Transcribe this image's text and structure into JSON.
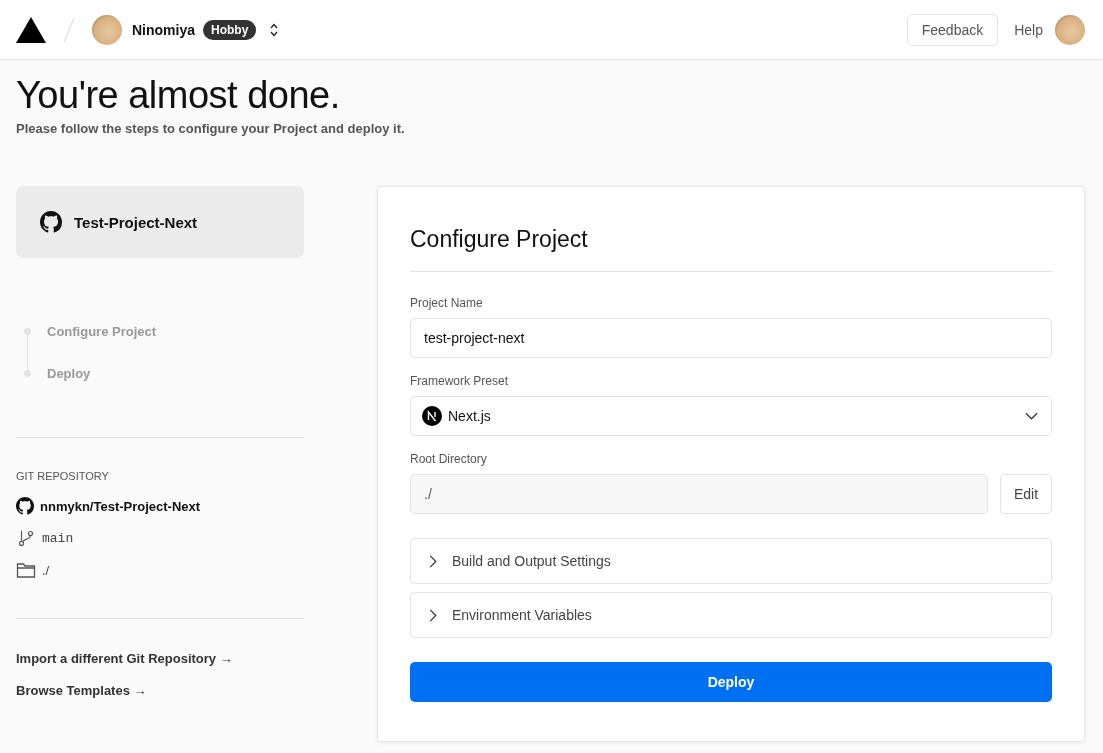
{
  "header": {
    "team_name": "Ninomiya",
    "plan_badge": "Hobby",
    "feedback_button": "Feedback",
    "help_link": "Help"
  },
  "page": {
    "title": "You're almost done.",
    "subtitle": "Please follow the steps to configure your Project and deploy it."
  },
  "sidebar": {
    "repo_card": "Test-Project-Next",
    "steps": [
      {
        "label": "Configure Project"
      },
      {
        "label": "Deploy"
      }
    ],
    "git_heading": "GIT REPOSITORY",
    "repository": "nnmykn/Test-Project-Next",
    "branch": "main",
    "directory": "./",
    "links": [
      "Import a different Git Repository →",
      "Browse Templates →"
    ]
  },
  "form": {
    "title": "Configure Project",
    "project_name": {
      "label": "Project Name",
      "value": "test-project-next"
    },
    "framework": {
      "label": "Framework Preset",
      "value": "Next.js"
    },
    "root_directory": {
      "label": "Root Directory",
      "value": "./",
      "edit_button": "Edit"
    },
    "sections": [
      {
        "label": "Build and Output Settings",
        "expanded": false
      },
      {
        "label": "Environment Variables",
        "expanded": false
      }
    ],
    "deploy_button": "Deploy"
  }
}
